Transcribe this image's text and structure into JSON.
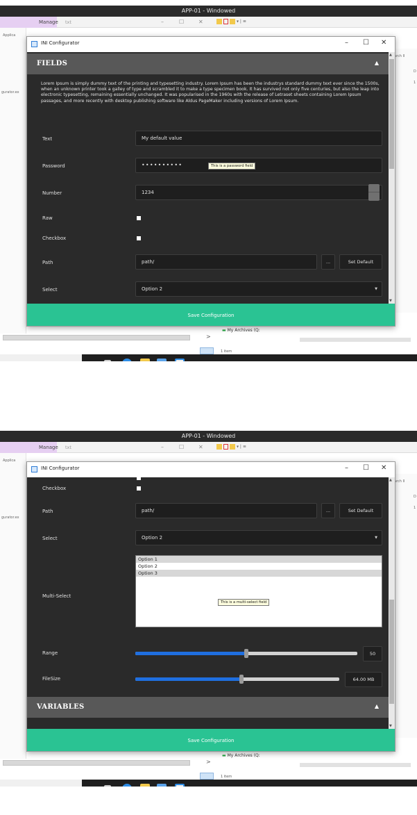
{
  "host": {
    "title": "APP-01 - Windowed",
    "manage_tab": "Manage",
    "tab_text": "txt",
    "ctrl_min": "–",
    "ctrl_max": "☐",
    "ctrl_close": "✕",
    "quick_access": "▾ | ≡",
    "left_label_1": "Applica",
    "left_label_2": "gurator.ex",
    "right_label_1": "arch II",
    "right_label_2": "D",
    "right_label_3": "1",
    "nav_arrow": ">",
    "archive_label": "My Archives (Q:",
    "items_count": "1 item"
  },
  "configurator": {
    "title": "INI Configurator",
    "ctrl_min": "–",
    "ctrl_max": "☐",
    "ctrl_close": "✕",
    "save_label": "Save Configuration",
    "fields_header": "FIELDS",
    "variables_header": "VARIABLES",
    "caret": "▲",
    "description": "Lorem Ipsum is simply dummy text of the printing and typesetting industry. Lorem Ipsum has been the industrys standard dummy text ever since the 1500s, when an unknown printer took a galley of type and scrambled it to make a type specimen book. It has survived not only five centuries, but also the leap into electronic typesetting, remaining essentially unchanged. It was popularised in the 1960s with the release of Letraset sheets containing Lorem Ipsum passages, and more recently with desktop publishing software like Aldus PageMaker including versions of Lorem Ipsum.",
    "fields": {
      "text_label": "Text",
      "text_value": "My default value",
      "password_label": "Password",
      "password_value": "••••••••••",
      "password_tooltip": "This is a password field",
      "number_label": "Number",
      "number_value": "1234",
      "raw_label": "Raw",
      "checkbox_label": "Checkbox",
      "path_label": "Path",
      "path_value": "path/",
      "browse_label": "...",
      "set_default_label": "Set Default",
      "select_label": "Select",
      "select_value": "Option 2",
      "select_arrow": "▼",
      "multiselect_label": "Multi-Select",
      "multiselect_options": [
        "Option 1",
        "Option 2",
        "Option 3"
      ],
      "multiselect_selected": [
        0,
        2
      ],
      "multiselect_tooltip": "This is a multi-select field",
      "range_label": "Range",
      "range_value": "50",
      "range_fraction": 0.5,
      "filesize_label": "FileSize",
      "filesize_value": "64.00 MB",
      "filesize_fraction": 0.52
    }
  },
  "colors": {
    "accent": "#2ac393",
    "panel_bg": "#2a2a2a",
    "header_bg": "#585858",
    "slider_fill": "#1f6fe0"
  }
}
